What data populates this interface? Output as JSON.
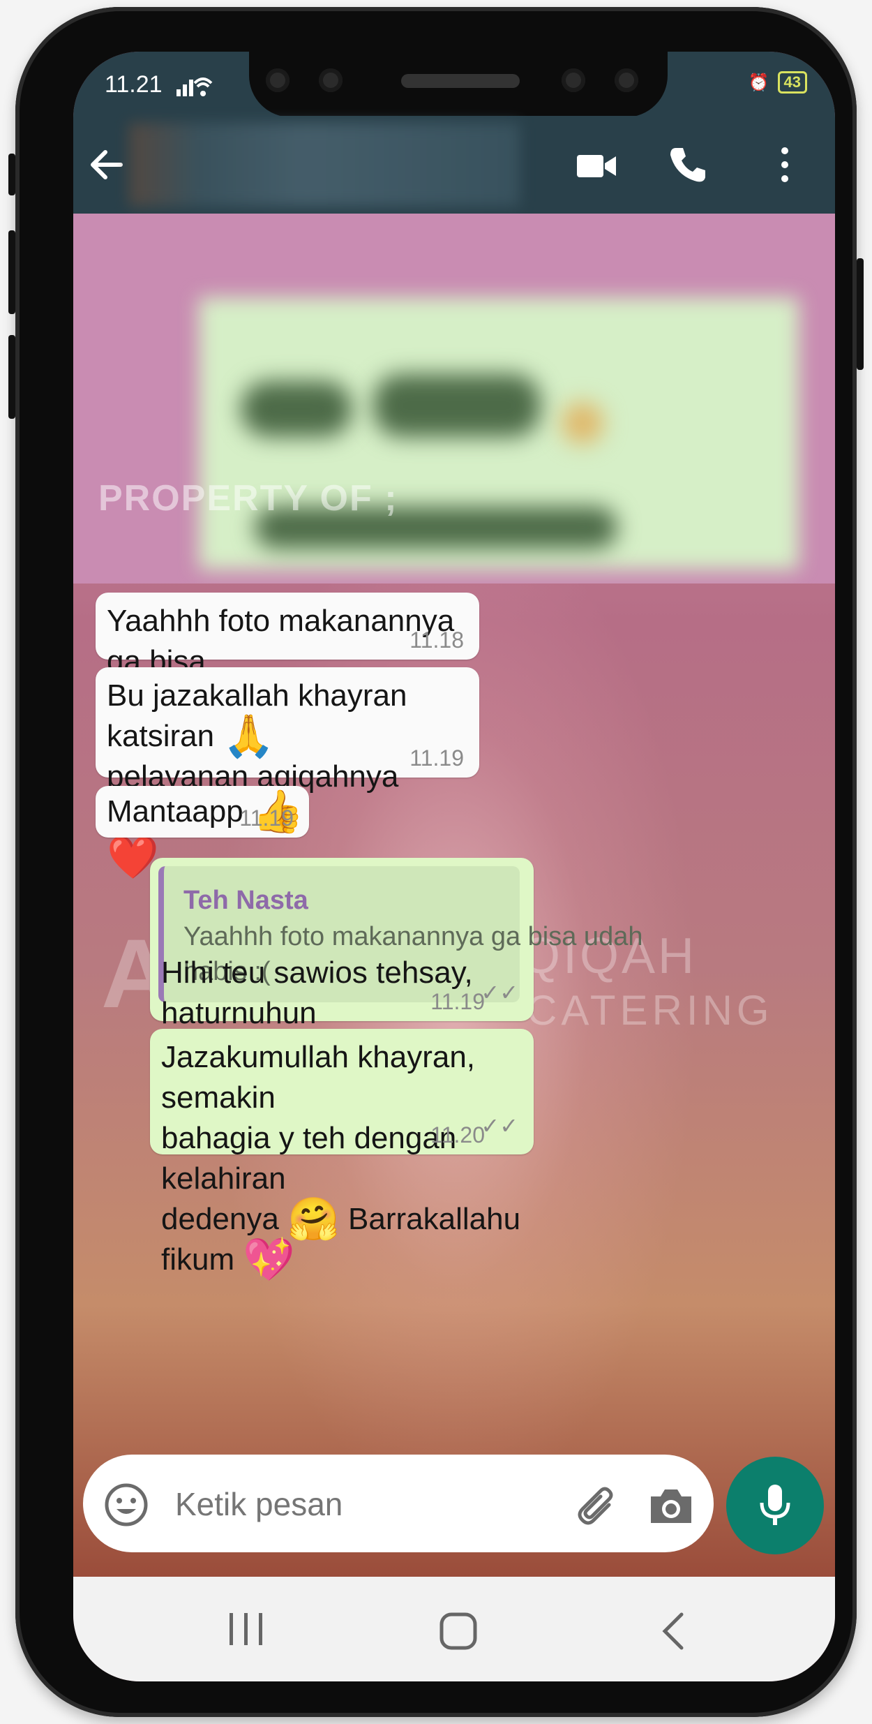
{
  "status_bar": {
    "time": "11.21",
    "battery": "43"
  },
  "overlay": {
    "watermark": "PROPERTY OF ;",
    "logo_main": "AL",
    "logo_line1": "AQIQAH",
    "logo_line2": "CATERING"
  },
  "messages": [
    {
      "direction": "in",
      "text": "Yaahhh foto makanannya ga bisa\nudah habis :(",
      "time": "11.18"
    },
    {
      "direction": "in",
      "text": "Bu jazakallah khayran katsiran",
      "emoji1": "🙏",
      "text2": "pelayanan aqiqahnya memuaskan",
      "emoji2": "❤️",
      "time": "11.19"
    },
    {
      "direction": "in",
      "text": "Mantaapp",
      "emoji1": "👍",
      "time": "11.19"
    },
    {
      "direction": "out",
      "quote_name": "Teh Nasta",
      "quote_text": "Yaahhh foto makanannya ga bisa udah\nhabis :(",
      "text": "Hihi teu sawios tehsay, haturnuhun",
      "emoji1": "💖",
      "time": "11.19",
      "ticks": "✓✓"
    },
    {
      "direction": "out",
      "text": "Jazakumullah khayran, semakin\nbahagia y teh dengan kelahiran\ndedenya",
      "emoji1": "🤗",
      "text2": "Barrakallahu fikum",
      "emoji2": "💖",
      "time": "11.20",
      "ticks": "✓✓"
    }
  ],
  "composer": {
    "placeholder": "Ketik pesan"
  },
  "colors": {
    "header": "#29404a",
    "out_bubble": "#dff7c6",
    "in_bubble": "#fafafa",
    "mic": "#0c7f6c"
  }
}
